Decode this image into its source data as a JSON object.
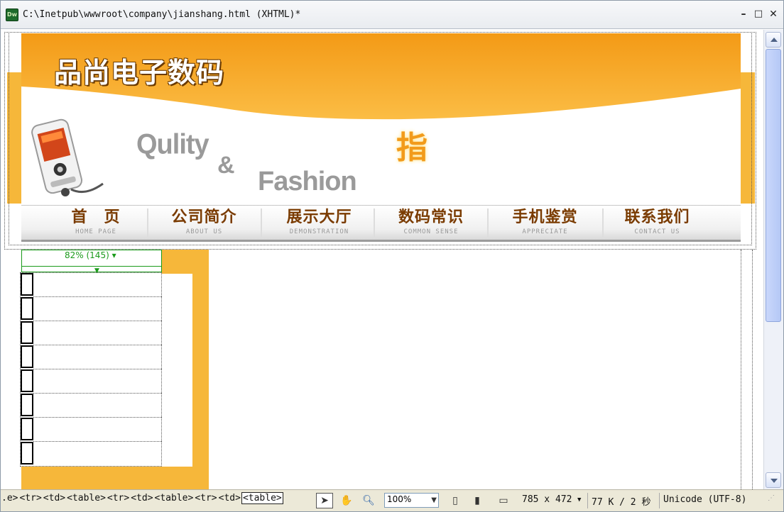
{
  "window": {
    "app_icon": "Dw",
    "title": "C:\\Inetpub\\wwwroot\\company\\jianshang.html (XHTML)*",
    "minimize": "–",
    "maximize": "□",
    "close": "✕"
  },
  "banner": {
    "brand": "品尚电子数码",
    "quality": "Qulity",
    "amp": "&",
    "fashion": "Fashion",
    "zhi": "指",
    "phone_icon": "mobile-phone-icon"
  },
  "nav": [
    {
      "zh": "首　页",
      "en": "HOME PAGE"
    },
    {
      "zh": "公司简介",
      "en": "ABOUT US"
    },
    {
      "zh": "展示大厅",
      "en": "DEMONSTRATION"
    },
    {
      "zh": "数码常识",
      "en": "COMMON SENSE"
    },
    {
      "zh": "手机鉴赏",
      "en": "APPRECIATE"
    },
    {
      "zh": "联系我们",
      "en": "CONTACT US"
    }
  ],
  "column_widget": {
    "label": "82% (145) ▾"
  },
  "statusbar": {
    "tags": [
      ".e>",
      "<tr>",
      "<td>",
      "<table>",
      "<tr>",
      "<td>",
      "<table>",
      "<tr>",
      "<td>",
      "<table>"
    ],
    "zoom": "100%",
    "window_size": "785 x 472",
    "download": "77 K / 2 秒",
    "encoding": "Unicode (UTF-8)"
  },
  "colors": {
    "accent_orange": "#f6b73a",
    "nav_text": "#7a3b00",
    "guide_green": "#1a9a1a"
  }
}
